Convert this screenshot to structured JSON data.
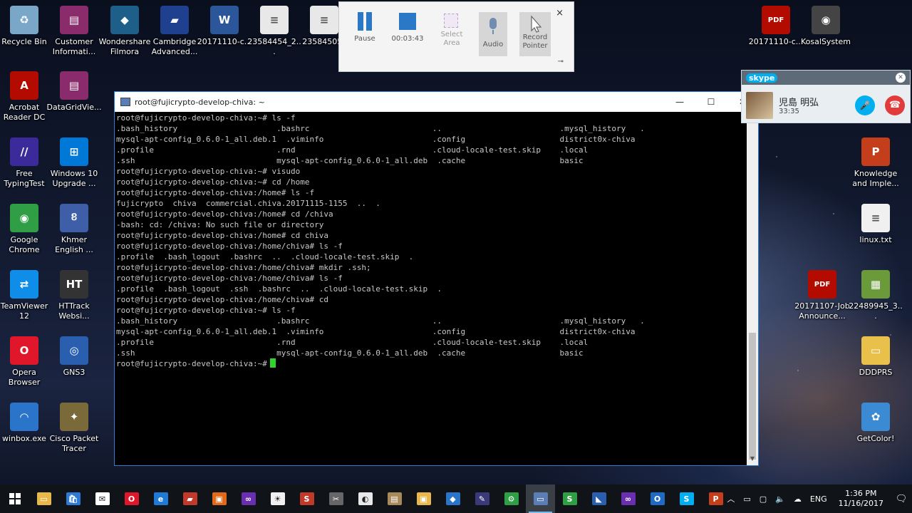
{
  "desktop_left": [
    {
      "label": "Recycle Bin",
      "color": "#7aa7c7",
      "glyph": "♻"
    },
    {
      "label": "Customer Informati...",
      "color": "#8a2b6b",
      "glyph": "▤"
    },
    {
      "label": "Wondershare Filmora",
      "color": "#1e5f8a",
      "glyph": "◆"
    },
    {
      "label": "Cambridge Advanced...",
      "color": "#1f3f8f",
      "glyph": "▰"
    },
    {
      "label": "20171110-c...",
      "color": "#2b579a",
      "glyph": "W"
    },
    {
      "label": "23584454_2...",
      "color": "#e8e8e8",
      "glyph": "≡"
    },
    {
      "label": "23584505_",
      "color": "#e8e8e8",
      "glyph": "≡"
    },
    {
      "label": "Acrobat Reader DC",
      "color": "#b30b00",
      "glyph": "A"
    },
    {
      "label": "DataGridVie...",
      "color": "#8a2b6b",
      "glyph": "▤"
    },
    {
      "label": "Free TypingTest",
      "color": "#3b2a9a",
      "glyph": "//"
    },
    {
      "label": "Windows 10 Upgrade ...",
      "color": "#0078d7",
      "glyph": "⊞"
    },
    {
      "label": "Google Chrome",
      "color": "#2f9e44",
      "glyph": "◉"
    },
    {
      "label": "Khmer English ...",
      "color": "#3e5fa8",
      "glyph": "ខ"
    },
    {
      "label": "TeamViewer 12",
      "color": "#0e8ee9",
      "glyph": "⇄"
    },
    {
      "label": "HTTrack Websi...",
      "color": "#333333",
      "glyph": "HT"
    },
    {
      "label": "Opera Browser",
      "color": "#e0162b",
      "glyph": "O"
    },
    {
      "label": "GNS3",
      "color": "#2a5fb0",
      "glyph": "◎"
    },
    {
      "label": "winbox.exe",
      "color": "#2a75c9",
      "glyph": "◠"
    },
    {
      "label": "Cisco Packet Tracer",
      "color": "#7a6a3a",
      "glyph": "✦"
    }
  ],
  "desktop_right": [
    {
      "label": "20171110-c...",
      "color": "#b30b00",
      "glyph": "PDF"
    },
    {
      "label": "KosalSystem",
      "color": "#444444",
      "glyph": "◉"
    },
    {
      "label": "Knowledge and Imple...",
      "color": "#c43e1c",
      "glyph": "P"
    },
    {
      "label": "linux.txt",
      "color": "#f0f0f0",
      "glyph": "≡"
    },
    {
      "label": "20171107-Job Announce...",
      "color": "#b30b00",
      "glyph": "PDF"
    },
    {
      "label": "22489945_3...",
      "color": "#6a9a3a",
      "glyph": "▦"
    },
    {
      "label": "DDDPRS",
      "color": "#e8c04a",
      "glyph": "▭"
    },
    {
      "label": "GetColor!",
      "color": "#3a8ad4",
      "glyph": "✿"
    }
  ],
  "recorder": {
    "pause": "Pause",
    "time": "00:03:43",
    "select_area": "Select Area",
    "audio": "Audio",
    "record_pointer": "Record Pointer",
    "close": "×"
  },
  "terminal": {
    "title": "root@fujicrypto-develop-chiva: ~",
    "lines": [
      "root@fujicrypto-develop-chiva:~# ls -f",
      ".bash_history                     .bashrc                          ..                         .mysql_history   .",
      "mysql-apt-config_0.6.0-1_all.deb.1  .viminfo                       .config                    district0x-chiva",
      ".profile                          .rnd                             .cloud-locale-test.skip    .local",
      ".ssh                              mysql-apt-config_0.6.0-1_all.deb  .cache                    basic",
      "root@fujicrypto-develop-chiva:~# visudo",
      "root@fujicrypto-develop-chiva:~# cd /home",
      "root@fujicrypto-develop-chiva:/home# ls -f",
      "fujicrypto  chiva  commercial.chiva.20171115-1155  ..  .",
      "root@fujicrypto-develop-chiva:/home# cd /chiva",
      "-bash: cd: /chiva: No such file or directory",
      "root@fujicrypto-develop-chiva:/home# cd chiva",
      "root@fujicrypto-develop-chiva:/home/chiva# ls -f",
      ".profile  .bash_logout  .bashrc  ..  .cloud-locale-test.skip  .",
      "root@fujicrypto-develop-chiva:/home/chiva# mkdir .ssh;",
      "root@fujicrypto-develop-chiva:/home/chiva# ls -f",
      ".profile  .bash_logout  .ssh  .bashrc  ..  .cloud-locale-test.skip  .",
      "root@fujicrypto-develop-chiva:/home/chiva# cd",
      "root@fujicrypto-develop-chiva:~# ls -f",
      ".bash_history                     .bashrc                          ..                         .mysql_history   .",
      "mysql-apt-config_0.6.0-1_all.deb.1  .viminfo                       .config                    district0x-chiva",
      ".profile                          .rnd                             .cloud-locale-test.skip    .local",
      ".ssh                              mysql-apt-config_0.6.0-1_all.deb  .cache                    basic"
    ],
    "prompt": "root@fujicrypto-develop-chiva:~#"
  },
  "skype": {
    "brand": "skype",
    "contact": "児島 明弘",
    "duration": "33:35"
  },
  "taskbar": {
    "apps": [
      {
        "name": "file-explorer",
        "color": "#e8b84a",
        "glyph": "▭"
      },
      {
        "name": "store",
        "color": "#2d7ad6",
        "glyph": "🛍"
      },
      {
        "name": "mail",
        "color": "#ffffff",
        "glyph": "✉"
      },
      {
        "name": "opera",
        "color": "#e0162b",
        "glyph": "O"
      },
      {
        "name": "edge",
        "color": "#1e7ad4",
        "glyph": "e"
      },
      {
        "name": "winrar",
        "color": "#c0392b",
        "glyph": "▰"
      },
      {
        "name": "app-orange",
        "color": "#e06a1a",
        "glyph": "▣"
      },
      {
        "name": "visual-studio",
        "color": "#6a2fb0",
        "glyph": "∞"
      },
      {
        "name": "brightness",
        "color": "#f0f0f0",
        "glyph": "☀"
      },
      {
        "name": "app-s",
        "color": "#c0392b",
        "glyph": "S"
      },
      {
        "name": "tools",
        "color": "#666666",
        "glyph": "✂"
      },
      {
        "name": "app-drop",
        "color": "#e8e8e8",
        "glyph": "◐"
      },
      {
        "name": "app-notes",
        "color": "#a88a5a",
        "glyph": "▤"
      },
      {
        "name": "app-yellow",
        "color": "#e8b84a",
        "glyph": "▣"
      },
      {
        "name": "app-tag",
        "color": "#2a75c9",
        "glyph": "◆"
      },
      {
        "name": "app-edit",
        "color": "#3a3a7a",
        "glyph": "✎"
      },
      {
        "name": "app-network",
        "color": "#2f9e44",
        "glyph": "⚙"
      },
      {
        "name": "putty",
        "color": "#5b7db5",
        "glyph": "▭",
        "active": true
      },
      {
        "name": "snipping",
        "color": "#2f9e44",
        "glyph": "S"
      },
      {
        "name": "app-blue",
        "color": "#2a5fb0",
        "glyph": "◣"
      },
      {
        "name": "vs-purple",
        "color": "#6a2fb0",
        "glyph": "∞"
      },
      {
        "name": "outlook",
        "color": "#1e6ac4",
        "glyph": "O"
      },
      {
        "name": "skype",
        "color": "#00aff0",
        "glyph": "S"
      },
      {
        "name": "powerpoint",
        "color": "#c43e1c",
        "glyph": "P"
      }
    ],
    "language": "ENG",
    "time": "1:36 PM",
    "date": "11/16/2017"
  }
}
